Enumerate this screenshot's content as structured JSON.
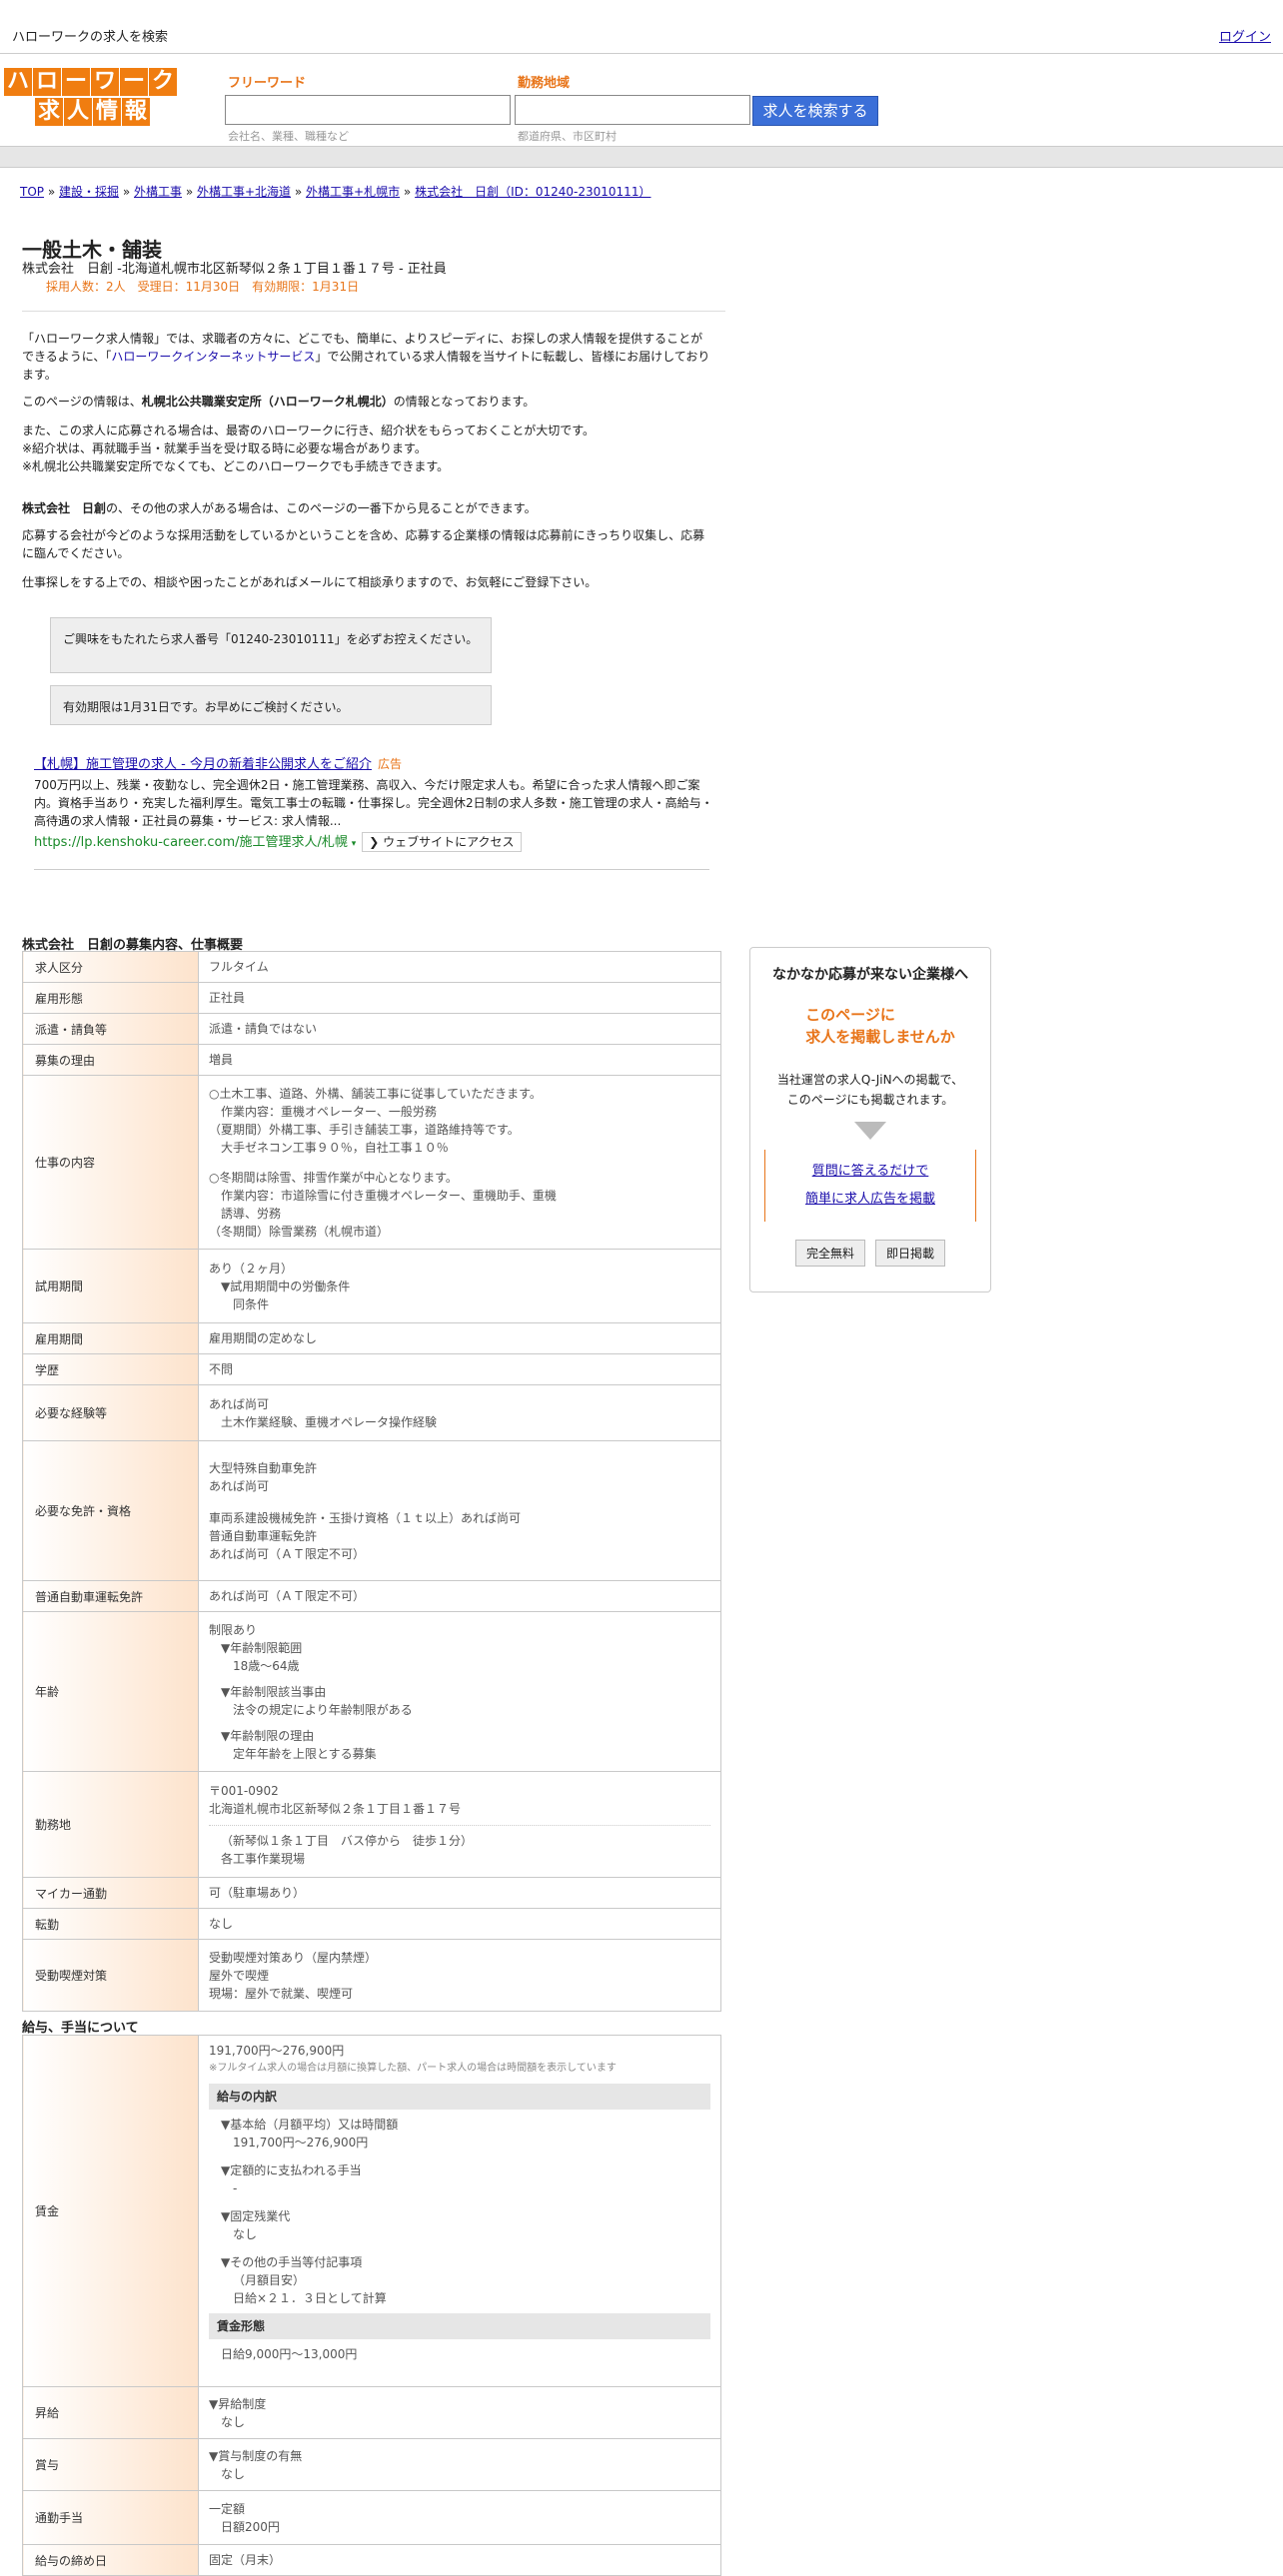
{
  "header": {
    "site_title": "ハローワークの求人を検索",
    "login": "ログイン",
    "logo_row1": [
      "ハ",
      "ロ",
      "ー",
      "ワ",
      "ー",
      "ク"
    ],
    "logo_row2": [
      "求",
      "人",
      "情",
      "報"
    ],
    "freeword_label": "フリーワード",
    "freeword_hint": "会社名、業種、職種など",
    "area_label": "勤務地域",
    "area_hint": "都道府県、市区町村",
    "search_button": "求人を検索する"
  },
  "breadcrumb": {
    "items": [
      "TOP",
      "建設・採掘",
      "外構工事",
      "外構工事+北海道",
      "外構工事+札幌市",
      "株式会社　日創（ID：01240-23010111）"
    ],
    "sep": " » "
  },
  "job": {
    "title": "一般土木・舗装",
    "subtitle": "株式会社　日創 -北海道札幌市北区新琴似２条１丁目１番１７号 - 正社員",
    "meta": "採用人数：2人　受理日：11月30日　有効期限：1月31日"
  },
  "intro": {
    "p1a": "「ハローワーク求人情報」では、求職者の方々に、どこでも、簡単に、よりスピーディに、お探しの求人情報を提供することができるように、「",
    "p1_link": "ハローワークインターネットサービス",
    "p1b": "」で公開されている求人情報を当サイトに転載し、皆様にお届けしております。",
    "p2a": "このページの情報は、",
    "p2_bold": "札幌北公共職業安定所（ハローワーク札幌北）",
    "p2b": "の情報となっております。",
    "p3": "また、この求人に応募される場合は、最寄のハローワークに行き、紹介状をもらっておくことが大切です。",
    "p3b": "※紹介状は、再就職手当・就業手当を受け取る時に必要な場合があります。",
    "p3c": "※札幌北公共職業安定所でなくても、どこのハローワークでも手続きできます。",
    "p4_bold": "株式会社　日創",
    "p4": "の、その他の求人がある場合は、このページの一番下から見ることができます。",
    "p5": "応募する会社が今どのような採用活動をしているかということを含め、応募する企業様の情報は応募前にきっちり収集し、応募に臨んでください。",
    "p6": "仕事探しをする上での、相談や困ったことがあればメールにて相談承りますので、お気軽にご登録下さい。",
    "box1": "ご興味をもたれたら求人番号「01240-23010111」を必ずお控えください。",
    "box2": "有効期限は1月31日です。お早めにご検討ください。"
  },
  "ad": {
    "title": "【札幌】施工管理の求人 - 今月の新着非公開求人をご紹介",
    "badge": "広告",
    "body": "700万円以上、残業・夜勤なし、完全週休2日・施工管理業務、高収入、今だけ限定求人も。希望に合った求人情報へ即ご案内。資格手当あり・充実した福利厚生。電気工事士の転職・仕事探し。完全週休2日制の求人多数・施工管理の求人・高給与・高待遇の求人情報・正社員の募集・サービス: 求人情報...",
    "url": "https://lp.kenshoku-career.com/施工管理求人/札幌",
    "action": "❯ ウェブサイトにアクセス"
  },
  "detail": {
    "section_title": "株式会社　日創の募集内容、仕事概要",
    "rows": {
      "kubun": {
        "label": "求人区分",
        "value": "フルタイム"
      },
      "keitai": {
        "label": "雇用形態",
        "value": "正社員"
      },
      "haken": {
        "label": "派遣・請負等",
        "value": "派遣・請負ではない"
      },
      "riyu": {
        "label": "募集の理由",
        "value": "増員"
      },
      "naiyo": {
        "label": "仕事の内容",
        "lines": [
          "○土木工事、道路、外構、舗装工事に従事していただきます。",
          "作業内容：重機オペレーター、一般労務",
          "（夏期間）外構工事、手引き舗装工事，道路維持等です。",
          "大手ゼネコン工事９０％，自社工事１０％",
          "○冬期間は除雪、排雪作業が中心となります。",
          "作業内容：市道除雪に付き重機オペレーター、重機助手、重機",
          "誘導、労務",
          "（冬期間）除雪業務（札幌市道）"
        ]
      },
      "shiyo": {
        "label": "試用期間",
        "lines": [
          "あり（２ヶ月）",
          "▼試用期間中の労働条件",
          "同条件"
        ]
      },
      "kikan": {
        "label": "雇用期間",
        "value": "雇用期間の定めなし"
      },
      "gakureki": {
        "label": "学歴",
        "value": "不問"
      },
      "keiken": {
        "label": "必要な経験等",
        "lines": [
          "あれば尚可",
          "土木作業経験、重機オペレータ操作経験"
        ]
      },
      "menkyo": {
        "label": "必要な免許・資格",
        "lines": [
          "大型特殊自動車免許",
          "あれば尚可",
          "車両系建設機械免許・玉掛け資格（１ｔ以上）あれば尚可",
          "普通自動車運転免許",
          "あれば尚可（ＡＴ限定不可）"
        ]
      },
      "futsu": {
        "label": "普通自動車運転免許",
        "value": "あれば尚可（ＡＴ限定不可）"
      },
      "nenrei": {
        "label": "年齢",
        "lines": [
          "制限あり",
          "▼年齢制限範囲",
          "18歳〜64歳",
          "▼年齢制限該当事由",
          "法令の規定により年齢制限がある",
          "▼年齢制限の理由",
          "定年年齢を上限とする募集"
        ]
      },
      "kinmuchi": {
        "label": "勤務地",
        "lines": [
          "〒001-0902",
          "北海道札幌市北区新琴似２条１丁目１番１７号",
          "（新琴似１条１丁目　バス停から　徒歩１分）",
          "各工事作業現場"
        ]
      },
      "mycar": {
        "label": "マイカー通勤",
        "value": "可（駐車場あり）"
      },
      "tenkin": {
        "label": "転勤",
        "value": "なし"
      },
      "kitsuen": {
        "label": "受動喫煙対策",
        "lines": [
          "受動喫煙対策あり（屋内禁煙）",
          "屋外で喫煙",
          "現場：屋外で就業、喫煙可"
        ]
      }
    }
  },
  "salary": {
    "section_title": "給与、手当について",
    "chingin": {
      "label": "賃金",
      "range": "191,700円〜276,900円",
      "note": "※フルタイム求人の場合は月額に換算した額、パート求人の場合は時間額を表示しています",
      "breakdown_head": "給与の内訳",
      "lines": [
        "▼基本給（月額平均）又は時間額",
        "191,700円〜276,900円",
        "▼定額的に支払われる手当",
        "-",
        "▼固定残業代",
        "なし",
        "▼その他の手当等付記事項",
        "（月額目安）",
        "日給×２１．３日として計算"
      ],
      "form_head": "賃金形態",
      "form_value": "日給9,000円〜13,000円"
    },
    "shokyu": {
      "label": "昇給",
      "lines": [
        "▼昇給制度",
        "なし"
      ]
    },
    "shoyo": {
      "label": "賞与",
      "lines": [
        "▼賞与制度の有無",
        "なし"
      ]
    },
    "tsukin": {
      "label": "通勤手当",
      "lines": [
        "一定額",
        "日額200円"
      ]
    },
    "shime": {
      "label": "給与の締め日",
      "value": "固定（月末）"
    }
  },
  "side": {
    "title": "なかなか応募が来ない企業様へ",
    "orange1": "このページに",
    "orange2": "求人を掲載しませんか",
    "text1": "当社運営の求人Q-JiNへの掲載で、",
    "text2": "このページにも掲載されます。",
    "link1": "質問に答えるだけで",
    "link2": "簡単に求人広告を掲載",
    "btn1": "完全無料",
    "btn2": "即日掲載"
  },
  "colors": {
    "accent": "#e8751a",
    "search_button": "#3b6fd8",
    "link": "#1a0dab",
    "ad_url": "#1a8a2a"
  }
}
